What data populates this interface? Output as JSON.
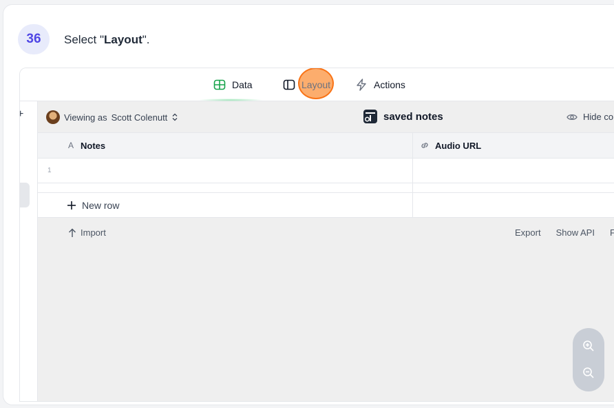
{
  "step": {
    "number": "36",
    "instruction_prefix": "Select \"",
    "instruction_bold": "Layout",
    "instruction_suffix": "\"."
  },
  "tabs": [
    {
      "label": "Data",
      "icon": "table-icon",
      "active": true
    },
    {
      "label": "Layout",
      "icon": "layout-icon",
      "active": false
    },
    {
      "label": "Actions",
      "icon": "lightning-icon",
      "active": false
    }
  ],
  "app": {
    "viewing_as_prefix": "Viewing as",
    "viewing_as_user": "Scott Colenutt",
    "table_title": "saved notes",
    "hide_columns_label": "Hide co"
  },
  "grid": {
    "columns": [
      {
        "type_icon": "A",
        "label": "Notes"
      },
      {
        "type_icon": "link-icon",
        "label": "Audio URL"
      }
    ],
    "rows": [
      {
        "num": "1",
        "notes": "",
        "audio_url": ""
      }
    ],
    "new_row_label": "New row"
  },
  "footer": {
    "import_label": "Import",
    "export_label": "Export",
    "show_api_label": "Show API",
    "truncated_label": "F"
  },
  "colors": {
    "accent": "#4f46e5",
    "active_tab_green": "#22c55e",
    "click_marker": "#f97316"
  }
}
